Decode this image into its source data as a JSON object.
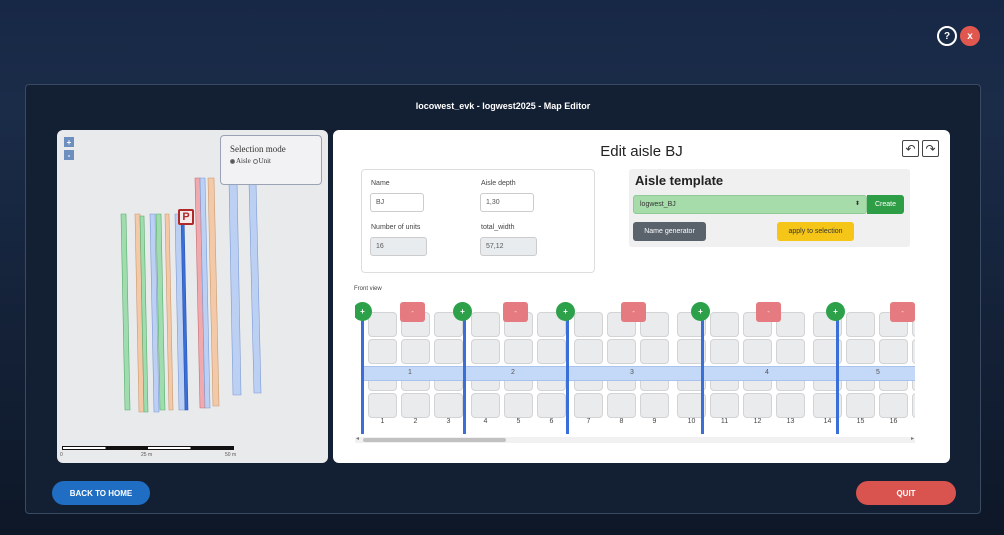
{
  "top": {
    "help_label": "?",
    "close_label": "x"
  },
  "title": "locowest_evk - logwest2025 - Map Editor",
  "map": {
    "zoom_in": "+",
    "zoom_out": "-",
    "selection_title": "Selection mode",
    "option_aisle": "Aisle",
    "option_unit": "Unit",
    "selected_mode": "Aisle",
    "marker": "P",
    "scale_labels": [
      "0",
      "25 m",
      "50 m"
    ]
  },
  "edit": {
    "title": "Edit aisle BJ",
    "undo_icon": "undo-icon",
    "redo_icon": "redo-icon",
    "name_label": "Name",
    "name_value": "BJ",
    "depth_label": "Aisle depth",
    "depth_value": "1,30",
    "units_label": "Number of units",
    "units_value": "16",
    "width_label": "total_width",
    "width_value": "57,12"
  },
  "template": {
    "title": "Aisle template",
    "selected": "logwest_BJ",
    "create_label": "Create",
    "name_generator_label": "Name generator",
    "apply_label": "apply to selection"
  },
  "front_view": {
    "label": "Front view",
    "bays": [
      "1",
      "2",
      "3",
      "4",
      "5"
    ],
    "units": [
      "1",
      "2",
      "3",
      "4",
      "5",
      "6",
      "7",
      "8",
      "9",
      "10",
      "11",
      "12",
      "13",
      "14",
      "15",
      "16"
    ],
    "plus_label": "+",
    "minus_label": "-"
  },
  "footer": {
    "back_label": "BACK TO HOME",
    "quit_label": "QUIT"
  },
  "colors": {
    "accent_blue": "#1f6ec4",
    "quit_red": "#d9534f",
    "create_green": "#2e9e46",
    "apply_yellow": "#f5c518"
  }
}
